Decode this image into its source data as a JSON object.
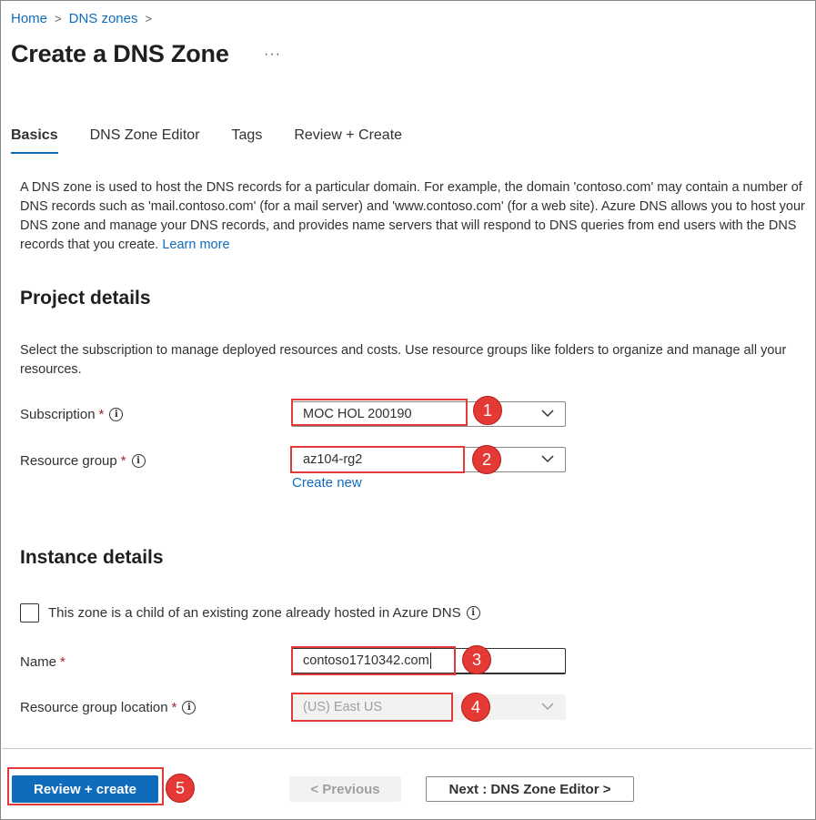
{
  "breadcrumb": {
    "home": "Home",
    "dns_zones": "DNS zones",
    "separator": ">"
  },
  "page": {
    "title": "Create a DNS Zone",
    "more": "···"
  },
  "tabs": [
    {
      "label": "Basics",
      "active": true
    },
    {
      "label": "DNS Zone Editor",
      "active": false
    },
    {
      "label": "Tags",
      "active": false
    },
    {
      "label": "Review + Create",
      "active": false
    }
  ],
  "description": {
    "text": "A DNS zone is used to host the DNS records for a particular domain. For example, the domain 'contoso.com' may contain a number of DNS records such as 'mail.contoso.com' (for a mail server) and 'www.contoso.com' (for a web site). Azure DNS allows you to host your DNS zone and manage your DNS records, and provides name servers that will respond to DNS queries from end users with the DNS records that you create.",
    "learn_more": "Learn more"
  },
  "project_details": {
    "heading": "Project details",
    "text": "Select the subscription to manage deployed resources and costs. Use resource groups like folders to organize and manage all your resources.",
    "subscription": {
      "label": "Subscription",
      "required": "*",
      "value": "MOC HOL 200190"
    },
    "resource_group": {
      "label": "Resource group",
      "required": "*",
      "value": "az104-rg2",
      "create_new": "Create new"
    }
  },
  "instance_details": {
    "heading": "Instance details",
    "child_zone": {
      "label": "This zone is a child of an existing zone already hosted in Azure DNS",
      "checked": false
    },
    "name": {
      "label": "Name",
      "required": "*",
      "value": "contoso1710342.com"
    },
    "location": {
      "label": "Resource group location",
      "required": "*",
      "value": "(US) East US"
    }
  },
  "footer": {
    "review_create": "Review + create",
    "previous": "< Previous",
    "next": "Next : DNS Zone Editor >"
  },
  "annotations": {
    "n1": "1",
    "n2": "2",
    "n3": "3",
    "n4": "4",
    "n5": "5"
  },
  "info_glyph": "i",
  "colors": {
    "accent": "#0f6cbd",
    "annotation_red": "#e53935",
    "required": "#a4262c"
  }
}
